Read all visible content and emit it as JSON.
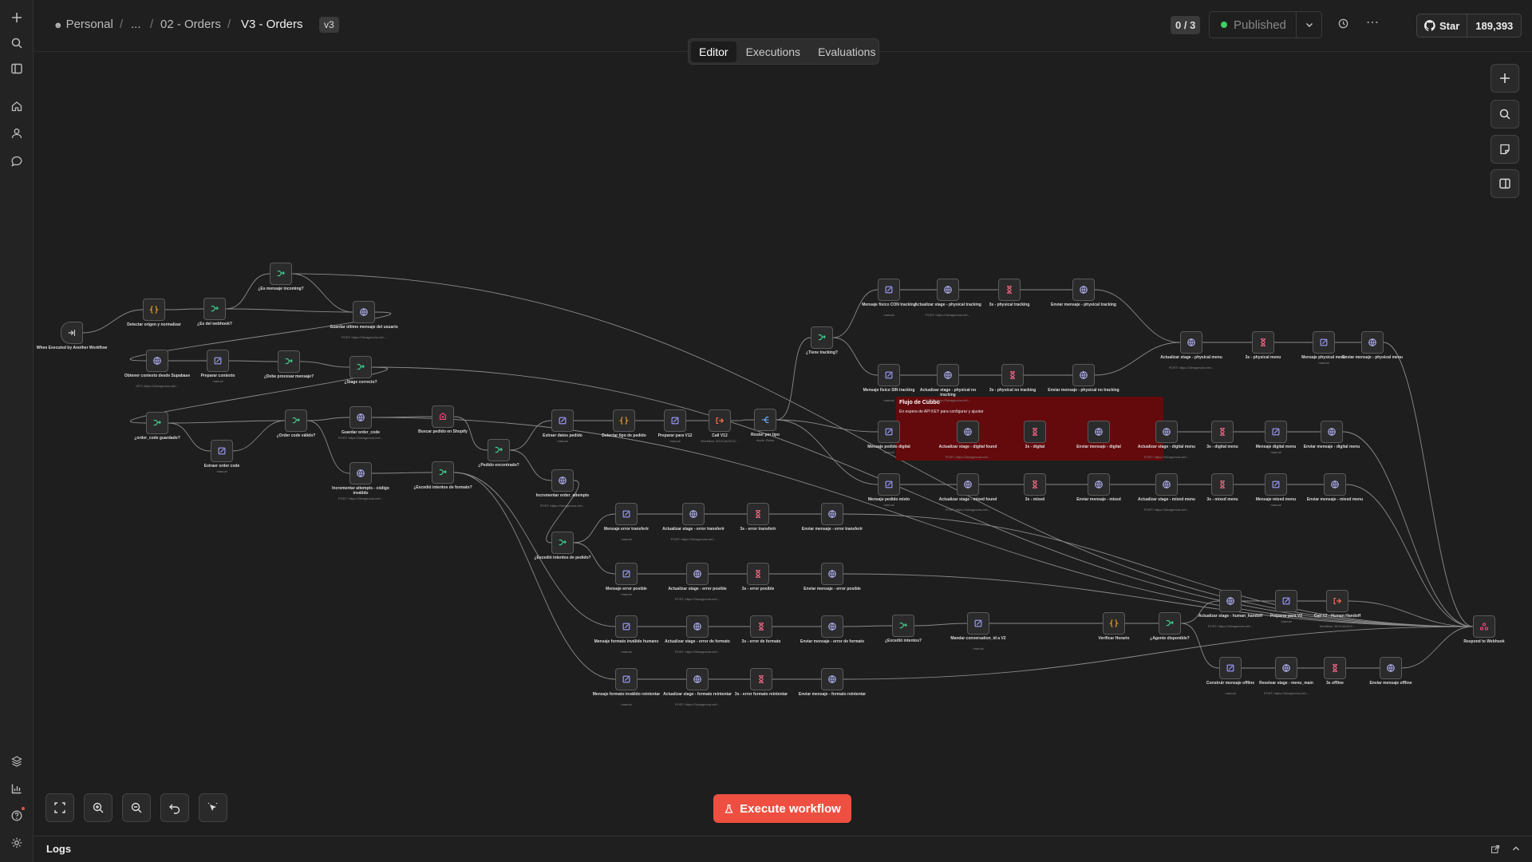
{
  "sidebar": {
    "top_icons": [
      "plus-icon",
      "search-icon",
      "panel-icon",
      "home-icon",
      "user-icon",
      "chat-icon"
    ],
    "bottom_icons": [
      "templates-icon",
      "insights-icon",
      "help-icon",
      "settings-icon"
    ]
  },
  "breadcrumb": {
    "personal": "Personal",
    "ellipsis": "...",
    "folder": "02 - Orders",
    "current": "V3 - Orders",
    "separator": "/"
  },
  "version_badge": "v3",
  "counter": "0 / 3",
  "publish": {
    "label": "Published",
    "status_color": "#3ecf63"
  },
  "github": {
    "star_label": "Star",
    "count": "189,393"
  },
  "tabs": [
    {
      "label": "Editor",
      "active": true
    },
    {
      "label": "Executions",
      "active": false
    },
    {
      "label": "Evaluations",
      "active": false
    }
  ],
  "execute_label": "Execute workflow",
  "logs_label": "Logs",
  "accent_color": "#ee4f40",
  "sticky": {
    "title": "Flujo de Cubbo",
    "body": "En espera de API KEY para configurar y ajustar"
  },
  "nodes": [
    {
      "label": "When Executed by Another Workflow",
      "sub": "",
      "icon": "trigger"
    },
    {
      "label": "Detectar origen y normalizar",
      "sub": "",
      "icon": "code"
    },
    {
      "label": "¿Es del webhook?",
      "sub": "",
      "icon": "if"
    },
    {
      "label": "¿Es mensaje incoming?",
      "sub": "",
      "icon": "if"
    },
    {
      "label": "Guardar último mensaje del usuario",
      "sub": "POST: https://3dvagencia.net/...",
      "icon": "http"
    },
    {
      "label": "Obtener contexto desde Supabase",
      "sub": "GET: https://3dvagencia.net/...",
      "icon": "http"
    },
    {
      "label": "Preparar contexto",
      "sub": "manual",
      "icon": "set"
    },
    {
      "label": "¿Debe procesar mensaje?",
      "sub": "",
      "icon": "if"
    },
    {
      "label": "¿Stage correcto?",
      "sub": "",
      "icon": "if"
    },
    {
      "label": "¿order_code guardado?",
      "sub": "",
      "icon": "if"
    },
    {
      "label": "Extraer order code",
      "sub": "manual",
      "icon": "set"
    },
    {
      "label": "¿Order code válido?",
      "sub": "",
      "icon": "if"
    },
    {
      "label": "Guardar order_code",
      "sub": "POST: https://3dvagencia.net/...",
      "icon": "http"
    },
    {
      "label": "Incrementar attempts - código inválido",
      "sub": "POST: https://3dvagencia.net/...",
      "icon": "http"
    },
    {
      "label": "Buscar pedido en Shopify",
      "sub": "",
      "icon": "shopify"
    },
    {
      "label": "¿Excedió intentos de formato?",
      "sub": "",
      "icon": "if"
    },
    {
      "label": "¿Pedido encontrado?",
      "sub": "",
      "icon": "if"
    },
    {
      "label": "Extraer datos pedido",
      "sub": "manual",
      "icon": "set"
    },
    {
      "label": "Detectar tipo de pedido",
      "sub": "",
      "icon": "code"
    },
    {
      "label": "Preparar para V12",
      "sub": "manual",
      "icon": "set"
    },
    {
      "label": "Call V12",
      "sub": "Workflow: 3DVCAV3V12...",
      "icon": "call"
    },
    {
      "label": "Router por tipo",
      "sub": "mode: Rules",
      "icon": "switch"
    },
    {
      "label": "Incrementar order_attempts",
      "sub": "POST: https://3dvagencia.net/...",
      "icon": "http"
    },
    {
      "label": "¿Excedió intentos de pedido?",
      "sub": "",
      "icon": "if"
    },
    {
      "label": "¿Tiene tracking?",
      "sub": "",
      "icon": "if"
    },
    {
      "label": "Mensaje físico CON tracking",
      "sub": "manual",
      "icon": "set"
    },
    {
      "label": "Actualizar stage - physical tracking",
      "sub": "POST: https://3dvagencia.net/...",
      "icon": "http"
    },
    {
      "label": "3s - physical tracking",
      "sub": "",
      "icon": "wait"
    },
    {
      "label": "Enviar mensaje - physical tracking",
      "sub": "",
      "icon": "http"
    },
    {
      "label": "Mensaje físico SIN tracking",
      "sub": "manual",
      "icon": "set"
    },
    {
      "label": "Actualizar stage - physical no tracking",
      "sub": "POST: https://3dvagencia.net/...",
      "icon": "http"
    },
    {
      "label": "3s - physical no tracking",
      "sub": "",
      "icon": "wait"
    },
    {
      "label": "Enviar mensaje - physical no tracking",
      "sub": "",
      "icon": "http"
    },
    {
      "label": "Actualizar stage - physical menu",
      "sub": "POST: https://3dvagencia.net/...",
      "icon": "http"
    },
    {
      "label": "3s - physical menu",
      "sub": "",
      "icon": "wait"
    },
    {
      "label": "Mensaje physical menu",
      "sub": "manual",
      "icon": "set"
    },
    {
      "label": "Enviar mensaje - physical menu",
      "sub": "",
      "icon": "http"
    },
    {
      "label": "Mensaje pedido digital",
      "sub": "manual",
      "icon": "set"
    },
    {
      "label": "Actualizar stage - digital found",
      "sub": "POST: https://3dvagencia.net/...",
      "icon": "http"
    },
    {
      "label": "3s - digital",
      "sub": "",
      "icon": "wait"
    },
    {
      "label": "Enviar mensaje - digital",
      "sub": "",
      "icon": "http"
    },
    {
      "label": "Actualizar stage - digital menu",
      "sub": "POST: https://3dvagencia.net/...",
      "icon": "http"
    },
    {
      "label": "3s - digital menu",
      "sub": "",
      "icon": "wait"
    },
    {
      "label": "Mensaje digital menu",
      "sub": "manual",
      "icon": "set"
    },
    {
      "label": "Enviar mensaje - digital menu",
      "sub": "",
      "icon": "http"
    },
    {
      "label": "Mensaje pedido mixto",
      "sub": "manual",
      "icon": "set"
    },
    {
      "label": "Actualizar stage - mixed found",
      "sub": "POST: https://3dvagencia.net/...",
      "icon": "http"
    },
    {
      "label": "3s - mixed",
      "sub": "",
      "icon": "wait"
    },
    {
      "label": "Enviar mensaje - mixed",
      "sub": "",
      "icon": "http"
    },
    {
      "label": "Actualizar stage - mixed menu",
      "sub": "POST: https://3dvagencia.net/...",
      "icon": "http"
    },
    {
      "label": "3s - mixed menu",
      "sub": "",
      "icon": "wait"
    },
    {
      "label": "Mensaje mixed menu",
      "sub": "manual",
      "icon": "set"
    },
    {
      "label": "Enviar mensaje - mixed menu",
      "sub": "",
      "icon": "http"
    },
    {
      "label": "Mensaje error transferir",
      "sub": "manual",
      "icon": "set"
    },
    {
      "label": "Actualizar stage - error transferir",
      "sub": "POST: https://3dvagencia.net/...",
      "icon": "http"
    },
    {
      "label": "3s - error transferir",
      "sub": "",
      "icon": "wait"
    },
    {
      "label": "Enviar mensaje - error transferir",
      "sub": "",
      "icon": "http"
    },
    {
      "label": "Mensaje error posible",
      "sub": "manual",
      "icon": "set"
    },
    {
      "label": "Actualizar stage - error posible",
      "sub": "POST: https://3dvagencia.net/...",
      "icon": "http"
    },
    {
      "label": "3s - error posible",
      "sub": "",
      "icon": "wait"
    },
    {
      "label": "Enviar mensaje - error posible",
      "sub": "",
      "icon": "http"
    },
    {
      "label": "Mensaje formato inválido humano",
      "sub": "manual",
      "icon": "set"
    },
    {
      "label": "Actualizar stage - error de formato",
      "sub": "POST: https://3dvagencia.net/...",
      "icon": "http"
    },
    {
      "label": "3s - error de formato",
      "sub": "",
      "icon": "wait"
    },
    {
      "label": "Enviar mensaje - error de formato",
      "sub": "",
      "icon": "http"
    },
    {
      "label": "¿Excedió intentos?",
      "sub": "",
      "icon": "if"
    },
    {
      "label": "Mandar conversation_id a V2",
      "sub": "manual",
      "icon": "set"
    },
    {
      "label": "Verificar Horario",
      "sub": "",
      "icon": "code"
    },
    {
      "label": "¿Agente disponible?",
      "sub": "",
      "icon": "if"
    },
    {
      "label": "Actualizar stage - human_handoff",
      "sub": "POST: https://3dvagencia.net/...",
      "icon": "http"
    },
    {
      "label": "Preparar para V2",
      "sub": "manual",
      "icon": "set"
    },
    {
      "label": "Call V2 - Human Handoff",
      "sub": "Workflow: 3DVCAV3V2...",
      "icon": "call"
    },
    {
      "label": "Respond to Webhook",
      "sub": "",
      "icon": "respond"
    },
    {
      "label": "Construir mensaje offline",
      "sub": "manual",
      "icon": "set"
    },
    {
      "label": "Resetear stage - menu_main",
      "sub": "POST: https://3dvagencia.net/...",
      "icon": "http"
    },
    {
      "label": "3s offline",
      "sub": "",
      "icon": "wait"
    },
    {
      "label": "Enviar mensaje offline",
      "sub": "",
      "icon": "http"
    },
    {
      "label": "Mensaje formato inválido reintentar",
      "sub": "manual",
      "icon": "set"
    },
    {
      "label": "Actualizar stage - formato reintentar",
      "sub": "POST: https://3dvagencia.net/...",
      "icon": "http"
    },
    {
      "label": "3s - error formato reintentar",
      "sub": "",
      "icon": "wait"
    },
    {
      "label": "Enviar mensaje - formato reintentar",
      "sub": "",
      "icon": "http"
    }
  ],
  "node_colors": {
    "if": "#3ecf8e",
    "set": "#a0a0ff",
    "http": "#b8b8ff",
    "wait": "#ff6b8a",
    "code": "#f5a623",
    "call": "#ff6a4d",
    "switch": "#6ab0ff",
    "trigger": "#cccccc",
    "shopify": "#ff3d7a",
    "respond": "#ff4a8a"
  }
}
